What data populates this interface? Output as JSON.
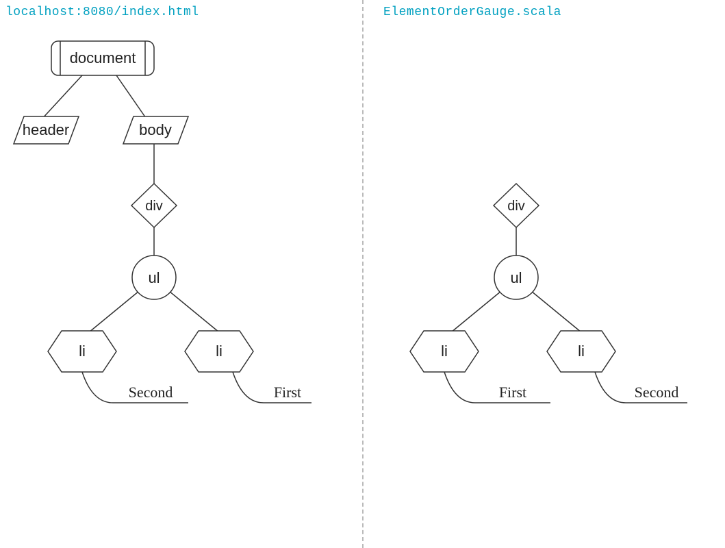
{
  "left": {
    "title": "localhost:8080/index.html",
    "nodes": {
      "document": "document",
      "header": "header",
      "body": "body",
      "div": "div",
      "ul": "ul",
      "li1": "li",
      "li2": "li",
      "leaf1": "Second",
      "leaf2": "First"
    }
  },
  "right": {
    "title": "ElementOrderGauge.scala",
    "nodes": {
      "div": "div",
      "ul": "ul",
      "li1": "li",
      "li2": "li",
      "leaf1": "First",
      "leaf2": "Second"
    }
  }
}
